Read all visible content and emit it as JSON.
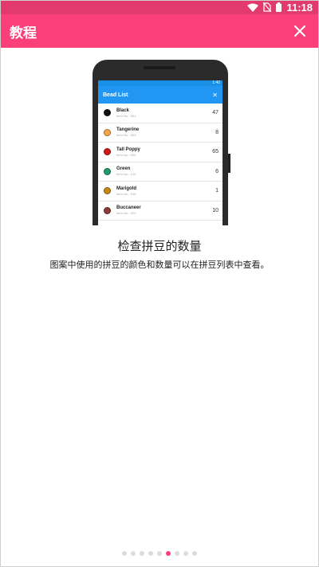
{
  "status_bar": {
    "time": "11:18",
    "icons": [
      "wifi-icon",
      "no-sim-icon",
      "battery-icon"
    ]
  },
  "app_bar": {
    "title": "教程",
    "close_icon": "close-icon",
    "background": "#fb3f7b"
  },
  "mockup": {
    "status_time": "1:40",
    "title": "Bead List",
    "close_glyph": "✕",
    "beads": [
      {
        "name": "Black",
        "item": "Item No.: S01",
        "count": "47",
        "color": "#111111"
      },
      {
        "name": "Tangerine",
        "item": "Item No.: S03",
        "count": "8",
        "color": "#f6a64a"
      },
      {
        "name": "Tall Poppy",
        "item": "Item No.: S05",
        "count": "65",
        "color": "#d01818"
      },
      {
        "name": "Green",
        "item": "Item No.: S16",
        "count": "6",
        "color": "#1f9b6a"
      },
      {
        "name": "Marigold",
        "item": "Item No.: S18",
        "count": "1",
        "color": "#c48a14"
      },
      {
        "name": "Buccaneer",
        "item": "Item No.: S20",
        "count": "10",
        "color": "#8c3a3a"
      }
    ]
  },
  "content": {
    "heading": "检查拼豆的数量",
    "subtitle": "图案中使用的拼豆的颜色和数量可以在拼豆列表中查看。"
  },
  "pager": {
    "total": 9,
    "active_index": 5,
    "active_color": "#fb3f7b",
    "inactive_color": "#dcdcdc"
  }
}
